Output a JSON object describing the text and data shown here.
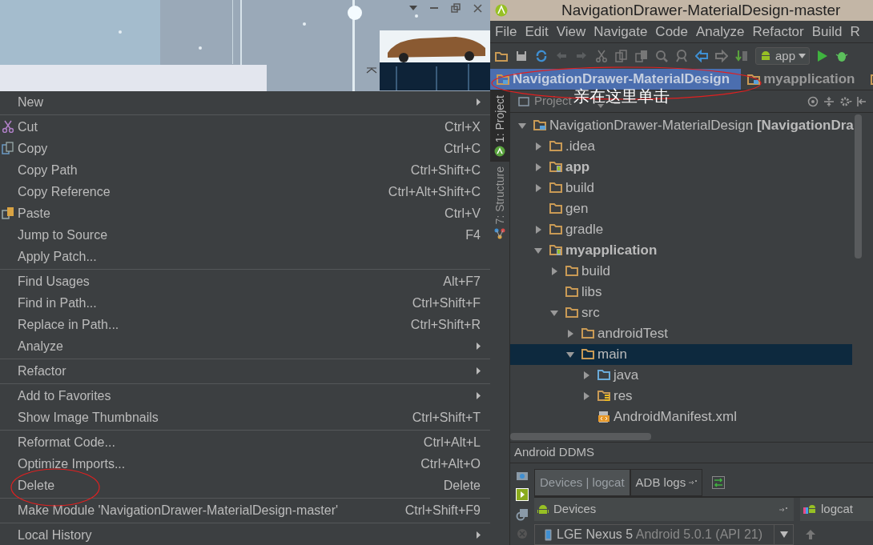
{
  "context_menu": [
    {
      "kind": "item",
      "label": "New",
      "submenu": true
    },
    {
      "kind": "separator"
    },
    {
      "kind": "item",
      "label": "Cut",
      "shortcut": "Ctrl+X",
      "submenu": false
    },
    {
      "kind": "item",
      "label": "Copy",
      "shortcut": "Ctrl+C",
      "submenu": false
    },
    {
      "kind": "item",
      "label": "Copy Path",
      "shortcut": "Ctrl+Shift+C",
      "submenu": false
    },
    {
      "kind": "item",
      "label": "Copy Reference",
      "shortcut": "Ctrl+Alt+Shift+C",
      "submenu": false
    },
    {
      "kind": "item",
      "label": "Paste",
      "shortcut": "Ctrl+V",
      "submenu": false
    },
    {
      "kind": "item",
      "label": "Jump to Source",
      "shortcut": "F4",
      "submenu": false
    },
    {
      "kind": "item",
      "label": "Apply Patch...",
      "submenu": false
    },
    {
      "kind": "separator"
    },
    {
      "kind": "item",
      "label": "Find Usages",
      "shortcut": "Alt+F7",
      "submenu": false
    },
    {
      "kind": "item",
      "label": "Find in Path...",
      "shortcut": "Ctrl+Shift+F",
      "submenu": false
    },
    {
      "kind": "item",
      "label": "Replace in Path...",
      "shortcut": "Ctrl+Shift+R",
      "submenu": false
    },
    {
      "kind": "item",
      "label": "Analyze",
      "submenu": true
    },
    {
      "kind": "separator"
    },
    {
      "kind": "item",
      "label": "Refactor",
      "submenu": true
    },
    {
      "kind": "separator"
    },
    {
      "kind": "item",
      "label": "Add to Favorites",
      "submenu": true
    },
    {
      "kind": "item",
      "label": "Show Image Thumbnails",
      "shortcut": "Ctrl+Shift+T",
      "submenu": false
    },
    {
      "kind": "separator"
    },
    {
      "kind": "item",
      "label": "Reformat Code...",
      "shortcut": "Ctrl+Alt+L",
      "submenu": false
    },
    {
      "kind": "item",
      "label": "Optimize Imports...",
      "shortcut": "Ctrl+Alt+O",
      "submenu": false
    },
    {
      "kind": "item",
      "label": "Delete",
      "shortcut": "Delete",
      "submenu": false
    },
    {
      "kind": "separator"
    },
    {
      "kind": "item",
      "label": "Make Module 'NavigationDrawer-MaterialDesign-master'",
      "shortcut": "Ctrl+Shift+F9",
      "submenu": false
    },
    {
      "kind": "separator"
    },
    {
      "kind": "item",
      "label": "Local History",
      "submenu": true
    }
  ],
  "window": {
    "title": "NavigationDrawer-MaterialDesign-master"
  },
  "menu_bar": [
    "File",
    "Edit",
    "View",
    "Navigate",
    "Code",
    "Analyze",
    "Refactor",
    "Build",
    "R"
  ],
  "toolbar": {
    "run_config": "app"
  },
  "breadcrumbs": [
    {
      "label": "NavigationDrawer-MaterialDesign",
      "selected": true
    },
    {
      "label": "myapplication",
      "selected": false
    }
  ],
  "tool_tabs": [
    {
      "label": "1: Project",
      "selected": true
    },
    {
      "label": "7: Structure",
      "selected": false
    }
  ],
  "project_panel": {
    "title": "Project",
    "tree": [
      {
        "kind": "project",
        "label": "NavigationDrawer-MaterialDesign **[NavigationDra**",
        "expanded": true,
        "selected": false,
        "children": [
          {
            "kind": "folder",
            "label": ".idea",
            "expanded": false,
            "selected": false
          },
          {
            "kind": "module",
            "label": "app",
            "expanded": false,
            "selected": false
          },
          {
            "kind": "folder",
            "label": "build",
            "expanded": false,
            "selected": false
          },
          {
            "kind": "folder",
            "label": "gen",
            "selected": false
          },
          {
            "kind": "folder",
            "label": "gradle",
            "expanded": false,
            "selected": false
          },
          {
            "kind": "module",
            "label": "myapplication",
            "expanded": true,
            "selected": false,
            "children": [
              {
                "kind": "folder",
                "label": "build",
                "expanded": false,
                "selected": false
              },
              {
                "kind": "folder",
                "label": "libs",
                "selected": false
              },
              {
                "kind": "folder",
                "label": "src",
                "expanded": true,
                "selected": false,
                "children": [
                  {
                    "kind": "folder",
                    "label": "androidTest",
                    "expanded": false,
                    "selected": false
                  },
                  {
                    "kind": "folder",
                    "label": "main",
                    "expanded": true,
                    "selected": true,
                    "children": [
                      {
                        "kind": "source",
                        "label": "java",
                        "expanded": false,
                        "selected": false
                      },
                      {
                        "kind": "resources",
                        "label": "res",
                        "expanded": false,
                        "selected": false
                      },
                      {
                        "kind": "manifest",
                        "label": "AndroidManifest.xml",
                        "selected": false
                      }
                    ]
                  }
                ]
              }
            ]
          }
        ]
      }
    ]
  },
  "ddms": {
    "title": "Android DDMS",
    "tabs": [
      {
        "label": "Devices | logcat",
        "selected": true
      },
      {
        "label": "ADB logs",
        "selected": false
      }
    ],
    "devices_title": "Devices",
    "logcat_title": "logcat",
    "device": {
      "name": "LGE Nexus 5",
      "detail": "Android 5.0.1 (API 21)"
    }
  },
  "annotations": [
    {
      "text": "亲在这里单击"
    }
  ]
}
